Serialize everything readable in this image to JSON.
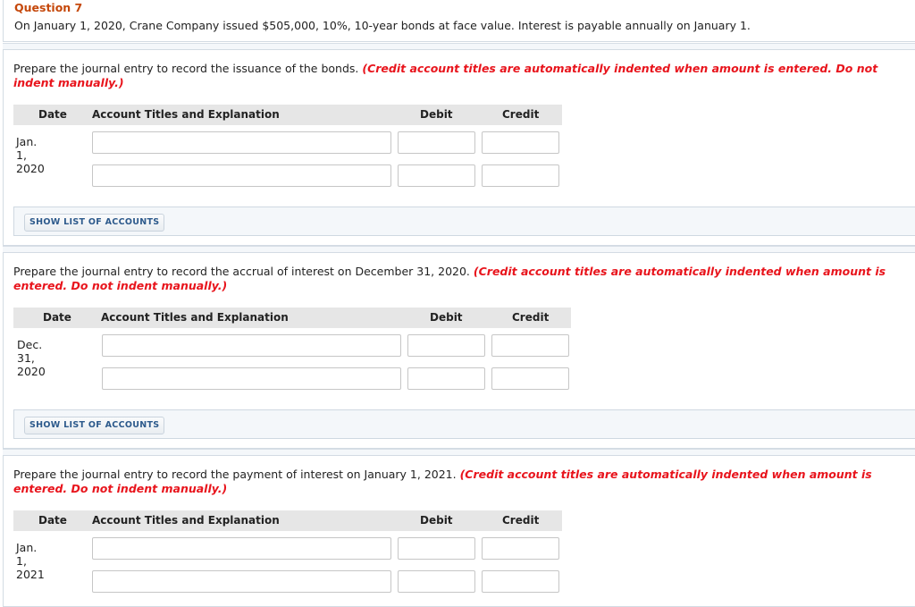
{
  "question": {
    "title": "Question 7",
    "text": "On January 1, 2020, Crane Company issued $505,000, 10%, 10-year bonds at face value. Interest is payable annually on January 1."
  },
  "colors": {
    "title": "#c5480b",
    "instruction_note": "#e8141c",
    "button_text": "#2d5a8c",
    "table_header_bg": "#e6e6e6"
  },
  "table_headers": {
    "date": "Date",
    "account": "Account Titles and Explanation",
    "debit": "Debit",
    "credit": "Credit"
  },
  "show_accounts_label": "SHOW LIST OF ACCOUNTS",
  "parts": [
    {
      "instruction": "Prepare the journal entry to record the issuance of the bonds.",
      "note": "(Credit account titles are automatically indented when amount is entered. Do not indent manually.)",
      "date": "Jan. 1, 2020",
      "rows": [
        {
          "account": "",
          "debit": "",
          "credit": ""
        },
        {
          "account": "",
          "debit": "",
          "credit": ""
        }
      ]
    },
    {
      "instruction": "Prepare the journal entry to record the accrual of interest on December 31, 2020.",
      "note": "(Credit account titles are automatically indented when amount is entered. Do not indent manually.)",
      "date": "Dec. 31, 2020",
      "rows": [
        {
          "account": "",
          "debit": "",
          "credit": ""
        },
        {
          "account": "",
          "debit": "",
          "credit": ""
        }
      ]
    },
    {
      "instruction": "Prepare the journal entry to record the payment of interest on January 1, 2021.",
      "note": "(Credit account titles are automatically indented when amount is entered. Do not indent manually.)",
      "date": "Jan. 1, 2021",
      "rows": [
        {
          "account": "",
          "debit": "",
          "credit": ""
        },
        {
          "account": "",
          "debit": "",
          "credit": ""
        }
      ]
    }
  ]
}
